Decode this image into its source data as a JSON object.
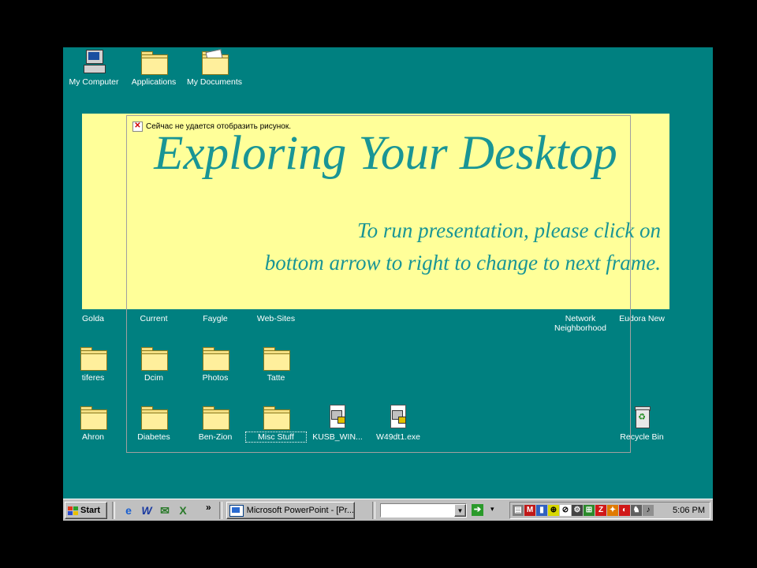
{
  "desktop": {
    "icons": [
      {
        "label": "My Computer"
      },
      {
        "label": "Applications"
      },
      {
        "label": "My Documents"
      },
      {
        "label": "Golda"
      },
      {
        "label": "Current"
      },
      {
        "label": "Faygle"
      },
      {
        "label": "Web-Sites"
      },
      {
        "label": "Network Neighborhood"
      },
      {
        "label": "Eudora New"
      },
      {
        "label": "tiferes"
      },
      {
        "label": "Dcim"
      },
      {
        "label": "Photos"
      },
      {
        "label": "Tatte"
      },
      {
        "label": "Ahron"
      },
      {
        "label": "Diabetes"
      },
      {
        "label": "Ben-Zion"
      },
      {
        "label": "Misc Stuff"
      },
      {
        "label": "KUSB_WIN..."
      },
      {
        "label": "W49dt1.exe"
      },
      {
        "label": "Recycle Bin"
      }
    ]
  },
  "slide": {
    "broken_image_text": "Сейчас не удается отобразить рисунок.",
    "title": "Exploring Your Desktop",
    "subtitle_line1": "To run presentation, please click on",
    "subtitle_line2": "bottom arrow to right to change to next frame."
  },
  "taskbar": {
    "start_label": "Start",
    "chevron": "»",
    "task_label": "Microsoft PowerPoint - [Pr...",
    "clock": "5:06 PM"
  },
  "colors": {
    "desktop": "#008080",
    "banner": "#ffff99",
    "title_text": "#199595"
  }
}
